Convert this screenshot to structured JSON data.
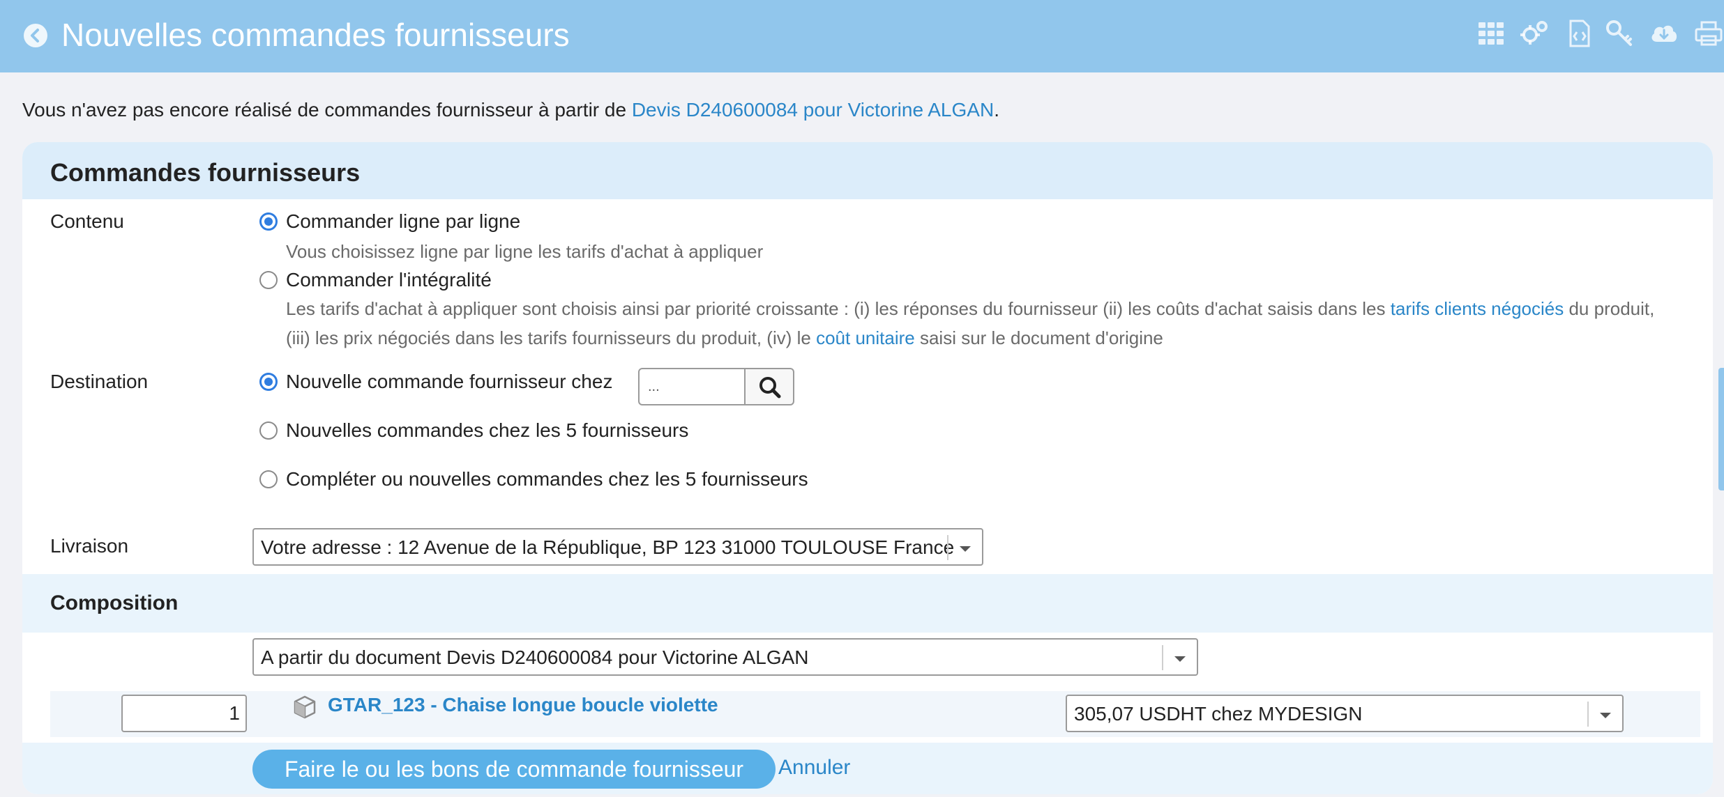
{
  "header": {
    "title": "Nouvelles commandes fournisseurs",
    "toolbar_icons": [
      "apps-grid-icon",
      "gears-icon",
      "code-file-icon",
      "key-icon",
      "cloud-download-icon",
      "printer-icon"
    ]
  },
  "intro": {
    "text": "Vous n'avez pas encore réalisé de commandes fournisseur à partir de ",
    "link": "Devis D240600084 pour Victorine ALGAN",
    "suffix": "."
  },
  "card": {
    "title": "Commandes fournisseurs",
    "contenu": {
      "label": "Contenu",
      "option1": "Commander ligne par ligne",
      "option1_help": "Vous choisissez ligne par ligne les tarifs d'achat à appliquer",
      "option2": "Commander l'intégralité",
      "option2_help_a": "Les tarifs d'achat à appliquer sont choisis ainsi par priorité croissante : (i) les réponses du fournisseur (ii) les coûts d'achat saisis dans les ",
      "option2_help_link1": "tarifs clients négociés",
      "option2_help_b": " du produit,",
      "option2_help_c": "(iii) les prix négociés dans les tarifs fournisseurs du produit, (iv) le ",
      "option2_help_link2": "coût unitaire",
      "option2_help_d": " saisi sur le document d'origine",
      "selected": "Commander ligne par ligne"
    },
    "destination": {
      "label": "Destination",
      "option1": "Nouvelle commande fournisseur chez",
      "supplier_placeholder": "...",
      "option2": "Nouvelles commandes chez les 5 fournisseurs",
      "option3": "Compléter ou nouvelles commandes chez les 5 fournisseurs",
      "selected": "Nouvelle commande fournisseur chez"
    },
    "livraison": {
      "label": "Livraison",
      "value": "Votre adresse : 12 Avenue de la République, BP 123 31000 TOULOUSE France"
    },
    "composition": {
      "title": "Composition",
      "source": "A partir du document Devis D240600084 pour Victorine ALGAN",
      "line": {
        "qty": "1",
        "product": "GTAR_123 - Chaise longue boucle violette",
        "price": "305,07 USDHT chez MYDESIGN"
      }
    },
    "actions": {
      "submit": "Faire le ou les bons de commande fournisseur",
      "cancel": "Annuler"
    }
  },
  "colors": {
    "header_bg": "#91c6ec",
    "link": "#2a86c8",
    "primary_button": "#5ab1e8",
    "radio_checked": "#2f7de0"
  }
}
